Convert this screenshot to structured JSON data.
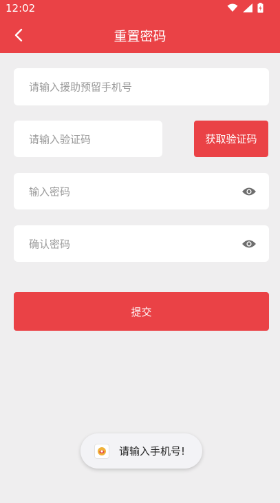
{
  "status_bar": {
    "time": "12:02",
    "icons": [
      "wifi-icon",
      "signal-icon",
      "battery-icon"
    ]
  },
  "header": {
    "title": "重置密码",
    "back_icon": "chevron-left-icon"
  },
  "form": {
    "phone_placeholder": "请输入援助预留手机号",
    "code_placeholder": "请输入验证码",
    "get_code_label": "获取验证码",
    "password_placeholder": "输入密码",
    "confirm_placeholder": "确认密码",
    "submit_label": "提交"
  },
  "toast": {
    "message": "请输入手机号!"
  },
  "colors": {
    "accent": "#ea4246",
    "background": "#efeeef",
    "placeholder": "#9a9a9a"
  }
}
